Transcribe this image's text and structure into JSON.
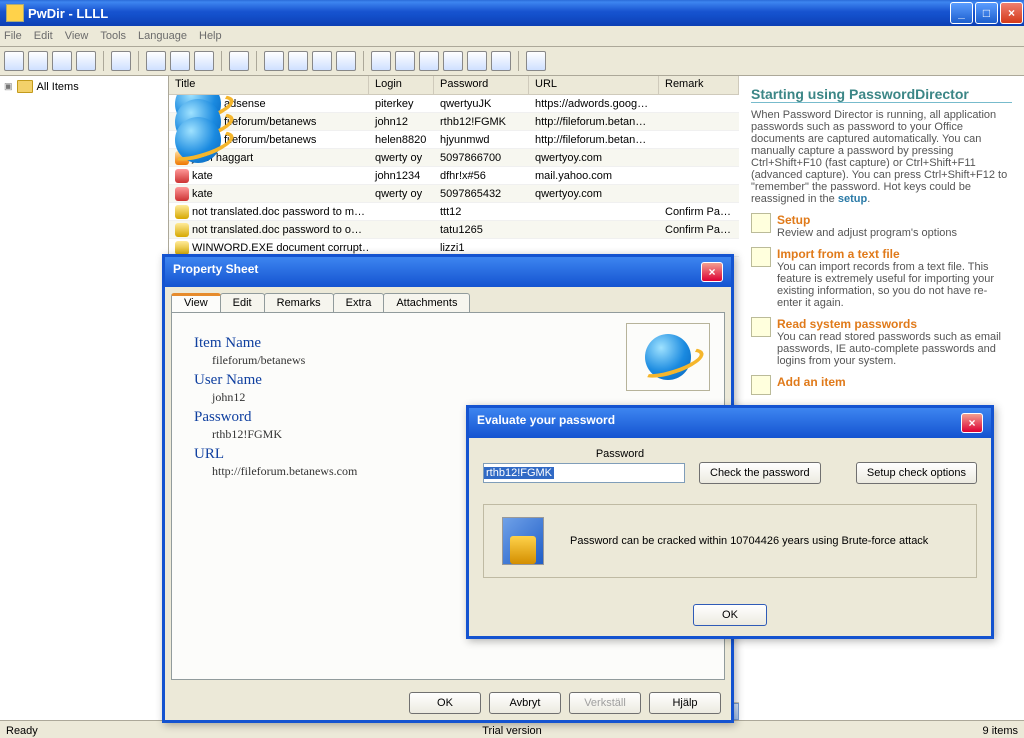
{
  "title": "PwDir - LLLL",
  "menu": [
    "File",
    "Edit",
    "View",
    "Tools",
    "Language",
    "Help"
  ],
  "tree": {
    "root": "All Items"
  },
  "grid": {
    "cols": {
      "title": "Title",
      "login": "Login",
      "password": "Password",
      "url": "URL",
      "remark": "Remark"
    },
    "rows": [
      {
        "icon": "ie",
        "title": "adsense",
        "login": "piterkey",
        "pw": "qwertyuJK",
        "url": "https://adwords.goog…",
        "rem": ""
      },
      {
        "icon": "ie",
        "title": "fileforum/betanews",
        "login": "john12",
        "pw": "rthb12!FGMK",
        "url": "http://fileforum.betan…",
        "rem": "",
        "alt": true
      },
      {
        "icon": "ie",
        "title": "fileforum/betanews",
        "login": "helen8820",
        "pw": "hjyunmwd",
        "url": "http://fileforum.betan…",
        "rem": ""
      },
      {
        "icon": "usr",
        "title": "john haggart",
        "login": "qwerty oy",
        "pw": "5097866700",
        "url": "qwertyoy.com",
        "rem": "",
        "alt": true
      },
      {
        "icon": "kate",
        "title": "kate",
        "login": "john1234",
        "pw": "dfhr!x#56",
        "url": "mail.yahoo.com",
        "rem": ""
      },
      {
        "icon": "kate",
        "title": "kate",
        "login": "qwerty oy",
        "pw": "5097865432",
        "url": "qwertyoy.com",
        "rem": "",
        "alt": true
      },
      {
        "icon": "doc",
        "title": "not translated.doc password to m…",
        "login": "",
        "pw": "ttt12",
        "url": "",
        "rem": "Confirm Passw"
      },
      {
        "icon": "doc",
        "title": "not translated.doc password to o…",
        "login": "",
        "pw": "tatu1265",
        "url": "",
        "rem": "Confirm Passw",
        "alt": true
      },
      {
        "icon": "doc",
        "title": "WINWORD.EXE document corrupt…",
        "login": "",
        "pw": "lizzi1",
        "url": "",
        "rem": ""
      }
    ]
  },
  "side": {
    "h": "Starting using PasswordDirector",
    "p1a": "When Password Director is running, all application passwords such as password to your Office documents are captured automatically. You can manually capture a password by pressing Ctrl+Shift+F10 (fast capture) or Ctrl+Shift+F11 (advanced capture). You can press Ctrl+Shift+F12 to \"remember\" the password. Hot keys could be reassigned in the ",
    "p1link": "setup",
    "p1b": ".",
    "s1h": "Setup",
    "s1t": "Review and adjust program's options",
    "s2h": "Import from a text file",
    "s2t": "You can import records from a text file. This feature is extremely useful for importing your existing information, so you do not have re-enter it again.",
    "s3h": "Read system passwords",
    "s3t": "You can read stored passwords such as email passwords, IE auto-complete passwords and logins from your system.",
    "s4h": "Add an item"
  },
  "prop": {
    "title": "Property Sheet",
    "tabs": [
      "View",
      "Edit",
      "Remarks",
      "Extra",
      "Attachments"
    ],
    "lbl_item": "Item Name",
    "val_item": "fileforum/betanews",
    "lbl_user": "User Name",
    "val_user": "john12",
    "lbl_pw": "Password",
    "val_pw": "rthb12!FGMK",
    "lbl_url": "URL",
    "val_url": "http://fileforum.betanews.com",
    "btn_ok": "OK",
    "btn_cancel": "Avbryt",
    "btn_apply": "Verkställ",
    "btn_help": "Hjälp"
  },
  "eval": {
    "title": "Evaluate your password",
    "lpw": "Password",
    "value": "rthb12!FGMK",
    "btn_check": "Check the password",
    "btn_opts": "Setup check options",
    "result": "Password can be cracked within 10704426 years using Brute-force attack",
    "ok": "OK"
  },
  "status": {
    "left": "Ready",
    "center": "Trial version",
    "right": "9 items"
  }
}
